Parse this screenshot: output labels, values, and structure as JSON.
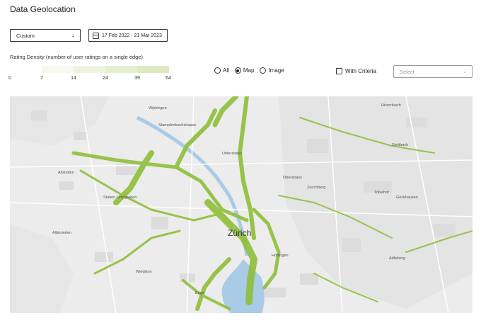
{
  "page_title": "Data Geolocation",
  "period_select": {
    "value": "Custom",
    "icon": "chevron-down-icon"
  },
  "date_range": {
    "value": "17 Feb 2022 - 21 Mar 2023",
    "icon": "calendar-icon"
  },
  "density": {
    "title": "Rating Density (number of user ratings on a single edge)",
    "ticks": [
      "0",
      "7",
      "14",
      "24",
      "39",
      "64"
    ],
    "colors": [
      "#ffffff",
      "#f6f9ee",
      "#eef4df",
      "#e5efcf",
      "#dde9c0"
    ]
  },
  "view_mode": {
    "options": [
      "All",
      "Map",
      "Image"
    ],
    "selected": "Map"
  },
  "criteria": {
    "label": "With Criteria",
    "checked": false
  },
  "criteria_select": {
    "placeholder": "Select",
    "icon": "chevron-down-icon"
  },
  "map": {
    "city_label": "Zürich",
    "road_color": "#8fbf3a",
    "labels": [
      "Wipkingen",
      "Unterstrass",
      "Stettbach",
      "Zürichberg",
      "Tobelhof",
      "Gockhausen",
      "Altstetten",
      "Station Letzigraben",
      "Albisrieden",
      "Wiedikon",
      "Enge",
      "Hottingen",
      "Adlisberg",
      "Oberstrass",
      "Stampfenbachstrasse",
      "Hirzenbach"
    ]
  }
}
